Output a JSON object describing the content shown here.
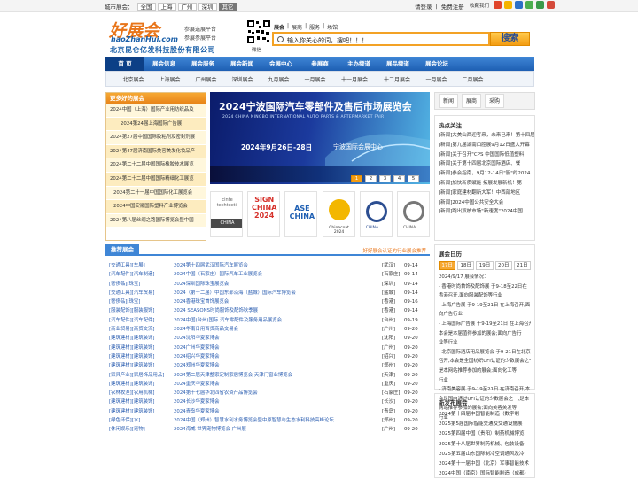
{
  "topbar": {
    "label": "城市展会：",
    "cities": [
      "全国",
      "上海",
      "广州",
      "深圳",
      "其它"
    ],
    "login": "请登录",
    "register": "免费注册",
    "favorite": "收藏我们"
  },
  "logo": {
    "mark": "好展会",
    "domain": "haoZhanHui.com",
    "slogan1": "参展选展平台",
    "slogan2": "参展参展平台",
    "company": "北京昆仑亿发科技股份有限公司"
  },
  "qr": {
    "caption": "微信"
  },
  "search": {
    "tabs": [
      "展会",
      "展商",
      "服务",
      "场馆"
    ],
    "value": "输入你关心的词，搜吧！！！",
    "button": "搜索"
  },
  "nav": [
    "首 页",
    "展会信息",
    "展会服务",
    "展会新闻",
    "会展中心",
    "参展商",
    "主办频道",
    "展品频道",
    "展会论坛"
  ],
  "subnav": [
    "北京展会",
    "上海展会",
    "广州展会",
    "深圳展会",
    "九月展会",
    "十月展会",
    "十一月展会",
    "十二月展会",
    "一月展会",
    "二月展会"
  ],
  "left_box": {
    "title": "更多好的展会",
    "items": [
      "2024中国（上海）国际产业用纺织品及",
      "2024第24届上海国际广告展",
      "2024第27届中国国际胶粘剂及密封剂展",
      "2024第47届济南国际美容美发化妆品产",
      "2024第二十二届中国国际橡胶技术展览",
      "2024第二十二届中国国际精细化工展览",
      "2024第二十一届中国国际化工展览会",
      "2024中国安徽国际塑料产业博览会",
      "2024第八届丝绸之路国际博览会暨中国"
    ]
  },
  "banner": {
    "title": "2024宁波国际汽车零部件及售后市场展览会",
    "subtitle": "2024 CHINA NINGBO INTERNATIONAL AUTO PARTS & AFTERMARKET FAIR",
    "date": "2024年9月26日-28日",
    "venue": "宁波国际会展中心",
    "dots": [
      "1",
      "2",
      "3",
      "4",
      "5"
    ]
  },
  "logos": [
    {
      "name": "cinte techtextil",
      "sub": "CHINA"
    },
    {
      "name": "SIGN CHINA 2024",
      "sub": ""
    },
    {
      "name": "ASE CHINA",
      "sub": ""
    },
    {
      "name": "Chinacoat 2024",
      "sub": ""
    },
    {
      "name": "CHINA",
      "sub": ""
    },
    {
      "name": "CHINA",
      "sub": ""
    }
  ],
  "news_tabs": [
    "新闻",
    "展商",
    "采购"
  ],
  "hot": {
    "title": "热点关注",
    "items": [
      "[新闻]大美山西迎客来，未来已来！第十四届",
      "[新闻]第九届湖南口腔展9月12日盛大开幕",
      "[新闻]关于召开\"CPS 中国国际低值塑料",
      "[新闻]关于第十四届北京国际酒店、餐",
      "[新闻]参会指南，9月12-14日\"厨\"约2024",
      "[新闻]加快新质赋能 拓展发展新机！第",
      "[新闻]家庭建材翻新大军！中西部地区",
      "[新闻]2024中国公共安全大会",
      "[新闻]跑出双核市场\"新速度\"2024中国"
    ]
  },
  "rec": {
    "title": "推荐展会",
    "more": "好好展会认证的行业展会推荐",
    "rows": [
      {
        "cat": "[交通工具][车展]",
        "title": "2024第十四届武汉国际汽车展览会",
        "city": "[武汉]",
        "date": "09-14"
      },
      {
        "cat": "[汽车配件][汽车制造]",
        "title": "2024中国（石家庄）国际汽车工业展览会",
        "city": "[石家庄]",
        "date": "09-14"
      },
      {
        "cat": "[奢侈品][珠宝]",
        "title": "2024深圳国际珠宝展览会",
        "city": "[深圳]",
        "date": "09-14"
      },
      {
        "cat": "[交通工具][汽车贸易]",
        "title": "2024（第十二届）中国东部沿海（盐城）国际汽车博览会",
        "city": "[盐城]",
        "date": "09-14"
      },
      {
        "cat": "[奢侈品][珠宝]",
        "title": "2024香港珠宝首饰展览会",
        "city": "[香港]",
        "date": "09-16"
      },
      {
        "cat": "[服装配饰][服装服饰]",
        "title": "2024 SEASONS时尚服饰及配饰秋季展",
        "city": "[香港]",
        "date": "09-14"
      },
      {
        "cat": "[汽车配件][汽车配件]",
        "title": "2024中国(台州)国际 汽车零配件及服务用品展览会",
        "city": "[台州]",
        "date": "09-19"
      },
      {
        "cat": "[商业贸易][商贸交流]",
        "title": "2024华南日用百货商品交易会",
        "city": "[广州]",
        "date": "09-20"
      },
      {
        "cat": "[建筑建材][建筑装饰]",
        "title": "2024沈阳华夏家博会",
        "city": "[沈阳]",
        "date": "09-20"
      },
      {
        "cat": "[建筑建材][建筑装饰]",
        "title": "2024广州华夏家博会",
        "city": "[广州]",
        "date": "09-20"
      },
      {
        "cat": "[建筑建材][建筑装饰]",
        "title": "2024绍兴华夏家博会",
        "city": "[绍兴]",
        "date": "09-20"
      },
      {
        "cat": "[建筑建材][建筑装饰]",
        "title": "2024郑州华夏家博会",
        "city": "[郑州]",
        "date": "09-20"
      },
      {
        "cat": "[家具产业][家居饰品用品]",
        "title": "2024第二届天津整家定制家居博览会·天津门窗业博览会",
        "city": "[天津]",
        "date": "09-20"
      },
      {
        "cat": "[建筑建材][建筑装饰]",
        "title": "2024重庆华夏家博会",
        "city": "[重庆]",
        "date": "09-20"
      },
      {
        "cat": "[农林牧渔][农用机械]",
        "title": "2024第十七届华北四省农资产品博览会",
        "city": "[石家庄]",
        "date": "09-20"
      },
      {
        "cat": "[建筑建材][建筑装饰]",
        "title": "2024长沙华夏家博会",
        "city": "[长沙]",
        "date": "09-20"
      },
      {
        "cat": "[建筑建材][建筑装饰]",
        "title": "2024青岛华夏家博会",
        "city": "[青岛]",
        "date": "09-20"
      },
      {
        "cat": "[绿色环保][水]",
        "title": "2024中国（郑州）智慧水利水务博览会暨中原智慧与生态水利科技高峰论坛",
        "city": "[郑州]",
        "date": "09-20"
      },
      {
        "cat": "[休闲娱乐][宠物]",
        "title": "2024海威·世界宠物博览会·广州展",
        "city": "[广州]",
        "date": "09-20"
      }
    ]
  },
  "calendar": {
    "title": "展会日历",
    "days": [
      "17日",
      "18日",
      "19日",
      "20日",
      "21日"
    ],
    "active_day": "17日",
    "lines": [
      "2024/9/17 展会情况：",
      "· 香港时尚首饰及配饰展 于9-18至22日在",
      "香港召开,面向服装配饰等行业",
      "· 上海广告展 于9-19至21日 在上海召开,面",
      "向广告行业",
      "· 上海国际广告展 于9-19至21日 在上海召开,",
      "本会是本届值得参加的展会;面向广告行",
      "业等行业",
      "· 北京国际酒店用品展览会 于9-21日在北京",
      "召开,本会是全国纺织UFI认证的少数展会之一;",
      "是本网站推荐参加的展会;面向化工等",
      "行业",
      "· 济南美容展 于9-19至21日 在济南召开,本",
      "会是国内通过UFI认证的少数展会之一,是本",
      "网站推荐参加的展会;面向美容美发等",
      "行业"
    ]
  },
  "new_release": {
    "title": "新发布展会",
    "items": [
      "2024第十四届中国智能制造（数字制",
      "2025第5届国际智能交通及交通设施展",
      "2025第四届中国（贵阳）制药机械博览",
      "2025第十八届世界制药机械、包装设备",
      "2025第五届山东国际制冷空调通风及冷",
      "2024第十一届中国（北京）军事智能技术",
      "2024中国（南京）国际智能制造（成都）"
    ]
  },
  "colors": {
    "accent": "#f39c12",
    "nav": "#1e5fb3",
    "link": "#2a5db0"
  }
}
